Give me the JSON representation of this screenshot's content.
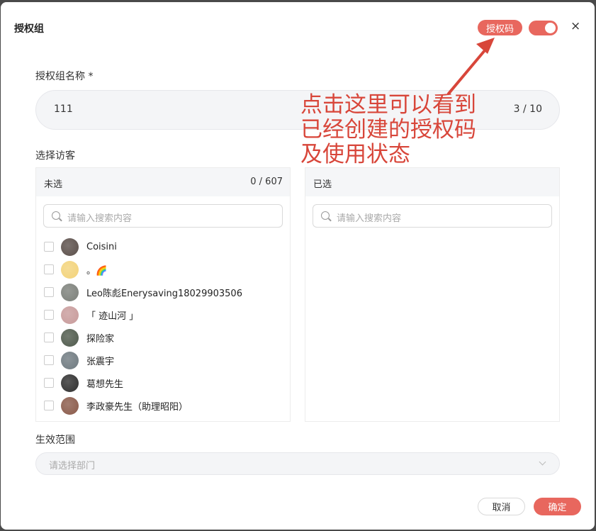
{
  "dialog": {
    "title": "授权组",
    "auth_code_label": "授权码",
    "toggle_on": true,
    "close_label": "×"
  },
  "name_field": {
    "label": "授权组名称 *",
    "value": "111",
    "count": "3 / 10"
  },
  "visitors": {
    "label": "选择访客",
    "unselected": {
      "title": "未选",
      "count": "0 / 607",
      "search_placeholder": "请输入搜索内容",
      "items": [
        {
          "label": "Coisini"
        },
        {
          "label": "。🌈"
        },
        {
          "label": "Leo陈彪Enerysaving18029903506"
        },
        {
          "label": "「 迹山河 」"
        },
        {
          "label": "探险家"
        },
        {
          "label": "张震宇"
        },
        {
          "label": "葛想先生"
        },
        {
          "label": "李政豪先生（助理昭阳）"
        }
      ]
    },
    "selected": {
      "title": "已选",
      "search_placeholder": "请输入搜索内容"
    }
  },
  "scope": {
    "label": "生效范围",
    "placeholder": "请选择部门"
  },
  "footer": {
    "cancel_label": "取消",
    "ok_label": "确定"
  },
  "annotation": {
    "text": "点击这里可以看到\n已经创建的授权码\n及使用状态"
  },
  "colors": {
    "accent": "#e8675e",
    "annotation": "#d8463a"
  }
}
